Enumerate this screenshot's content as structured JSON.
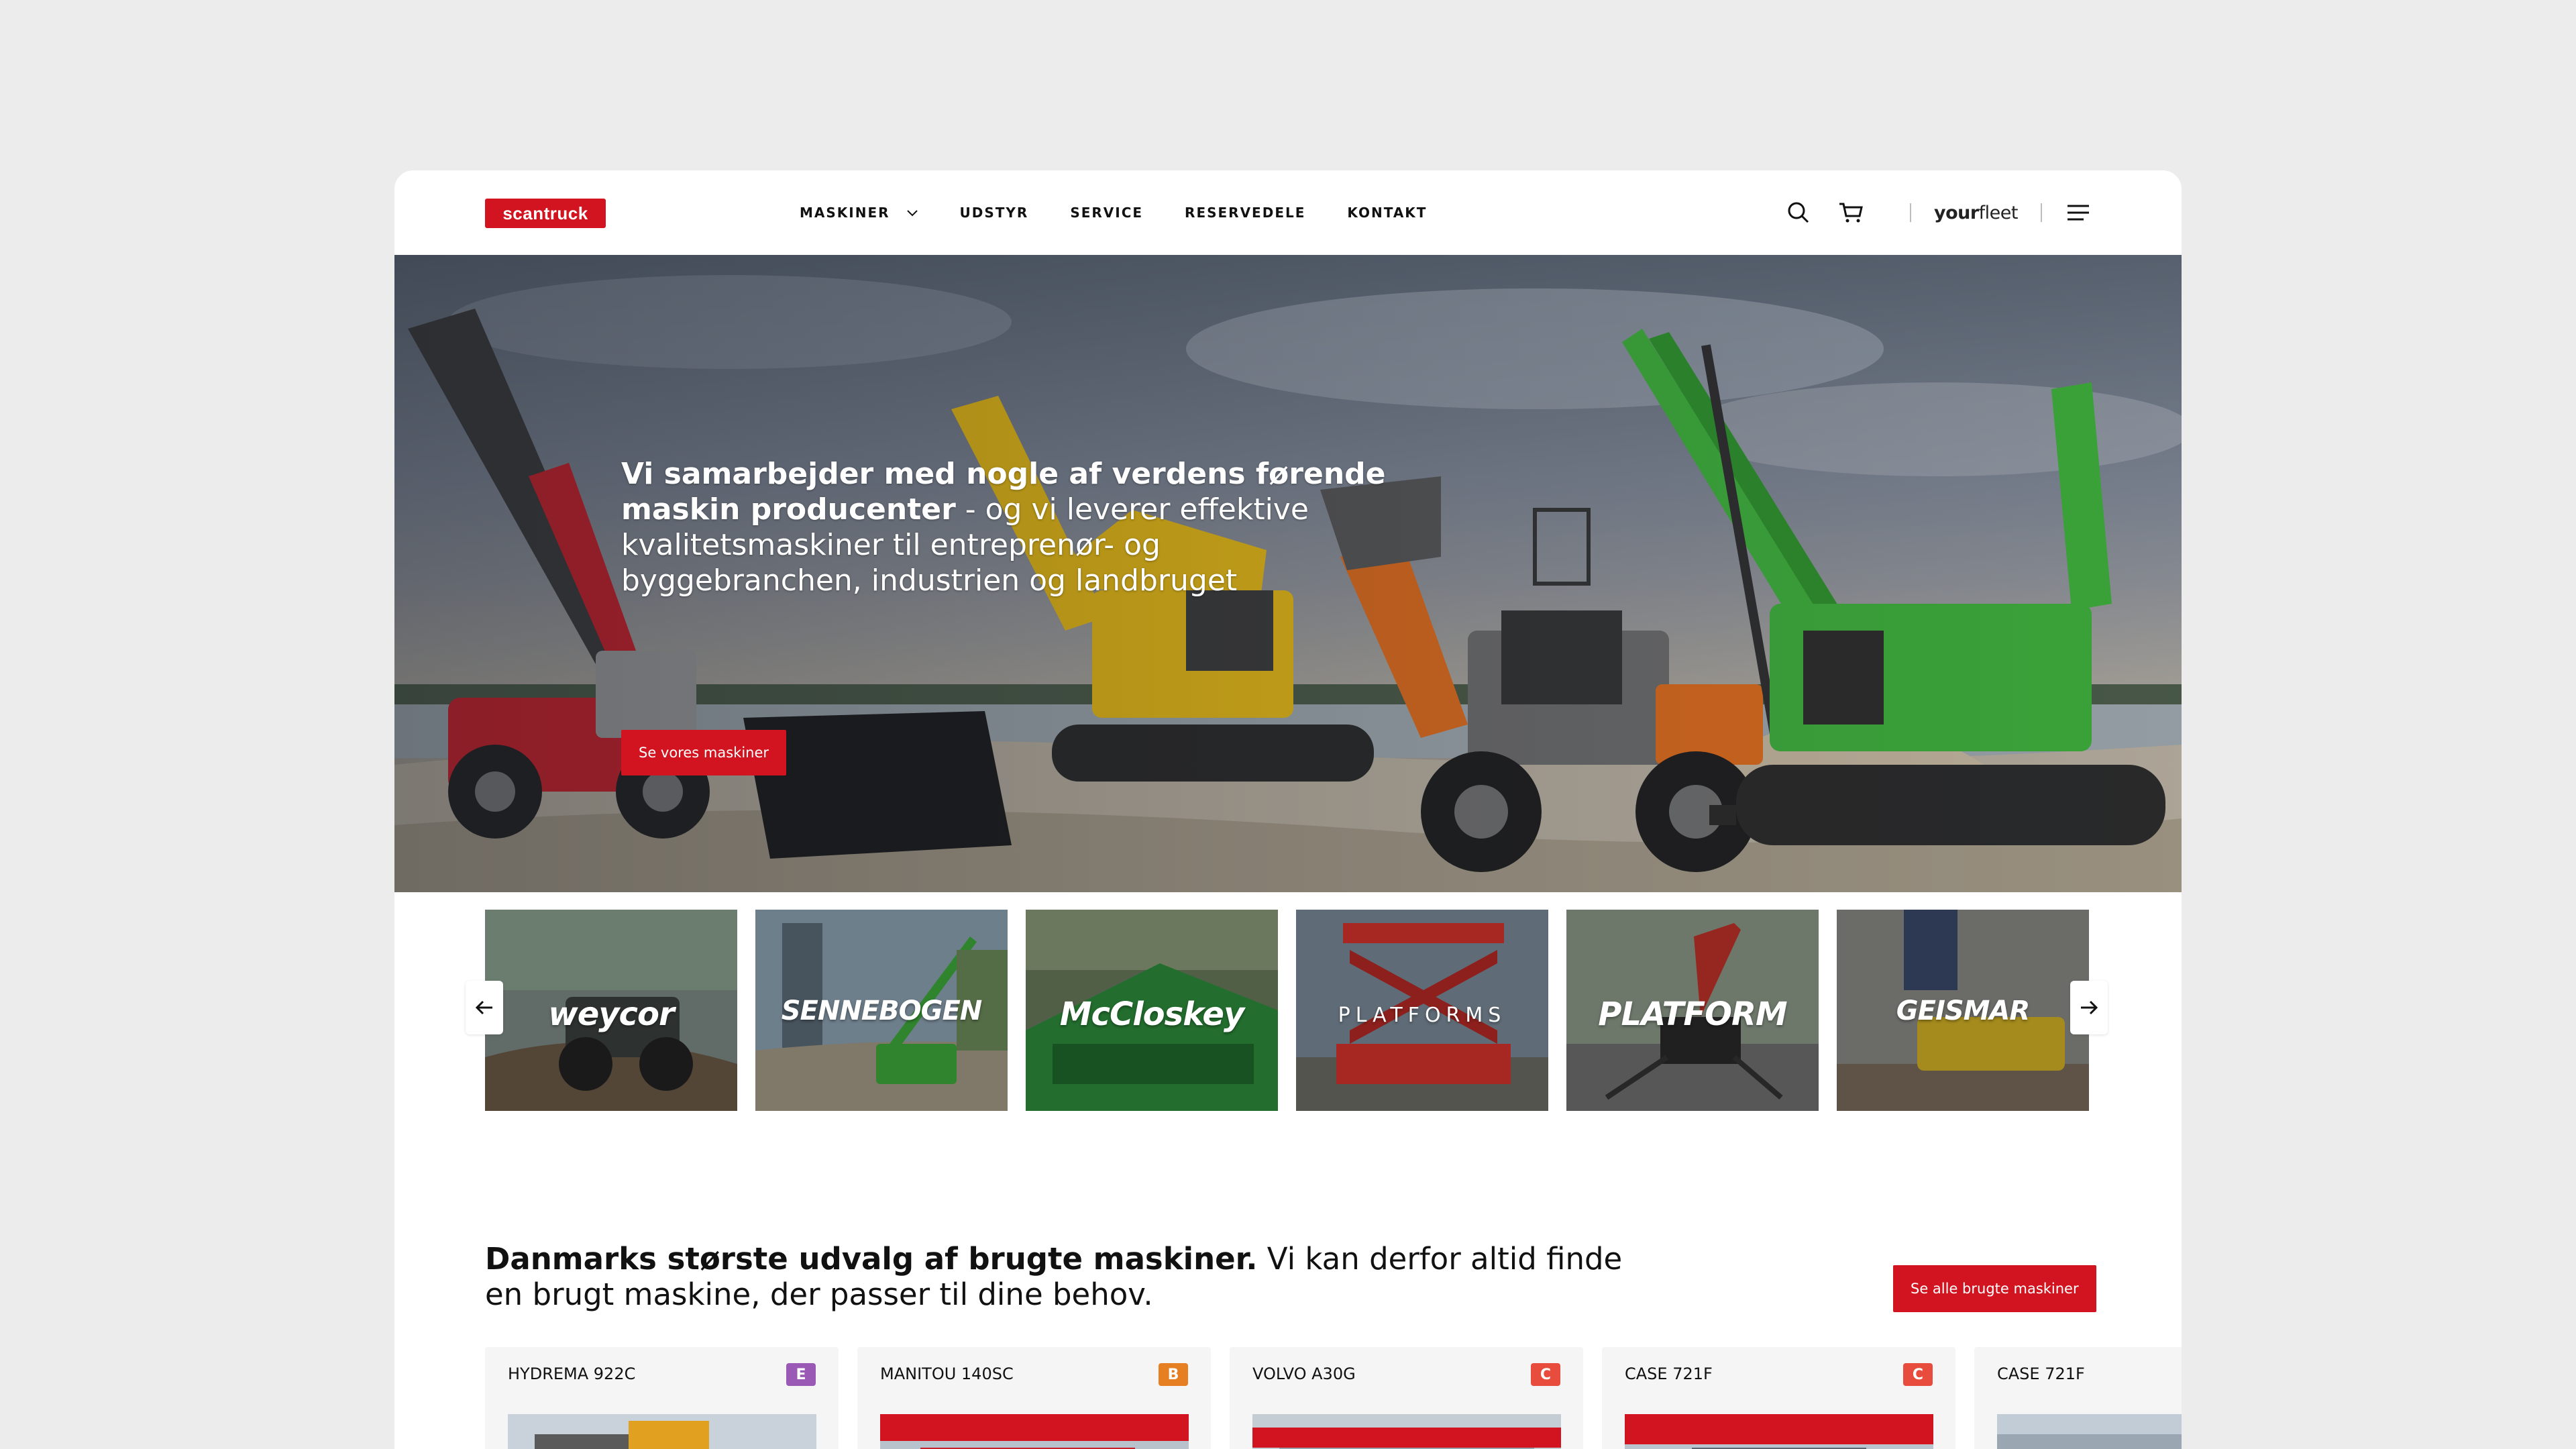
{
  "header": {
    "logo_text": "scantruck",
    "nav": [
      {
        "label": "MASKINER",
        "has_dropdown": true
      },
      {
        "label": "UDSTYR"
      },
      {
        "label": "SERVICE"
      },
      {
        "label": "RESERVEDELE"
      },
      {
        "label": "KONTAKT"
      }
    ],
    "icons": [
      "search-icon",
      "cart-icon",
      "menu-icon"
    ],
    "yourfleet_bold": "your",
    "yourfleet_light": "fleet"
  },
  "hero": {
    "headline_bold": "Vi samarbejder med nogle af verdens førende maskin producenter",
    "headline_rest": " - og vi leverer effektive kvalitetsmaskiner til entreprenør- og byggebranchen, industrien og landbruget",
    "button_label": "Se vores maskiner"
  },
  "brands": [
    {
      "name": "weycor",
      "style": "italic"
    },
    {
      "name": "SENNEBOGEN",
      "style": "italic"
    },
    {
      "name": "McCloskey",
      "style": "italic"
    },
    {
      "name": "PLATFORMS",
      "style": "thin"
    },
    {
      "name": "PLATFORM",
      "style": "italic"
    },
    {
      "name": "GEISMAR",
      "style": "italic"
    }
  ],
  "used": {
    "heading_bold": "Danmarks største udvalg af brugte maskiner.",
    "heading_rest": " Vi kan derfor altid finde en brugt maskine, der passer til dine behov.",
    "button_label": "Se alle brugte maskiner",
    "machines": [
      {
        "title": "HYDREMA 922C",
        "badge": "E",
        "badge_color": "#9b59b6"
      },
      {
        "title": "MANITOU 140SC",
        "badge": "B",
        "badge_color": "#e67e22"
      },
      {
        "title": "VOLVO A30G",
        "badge": "C",
        "badge_color": "#e74c3c"
      },
      {
        "title": "CASE 721F",
        "badge": "C",
        "badge_color": "#e74c3c"
      },
      {
        "title": "CASE 721F",
        "badge": "",
        "badge_color": ""
      }
    ]
  },
  "colors": {
    "brand_red": "#d1141f"
  }
}
